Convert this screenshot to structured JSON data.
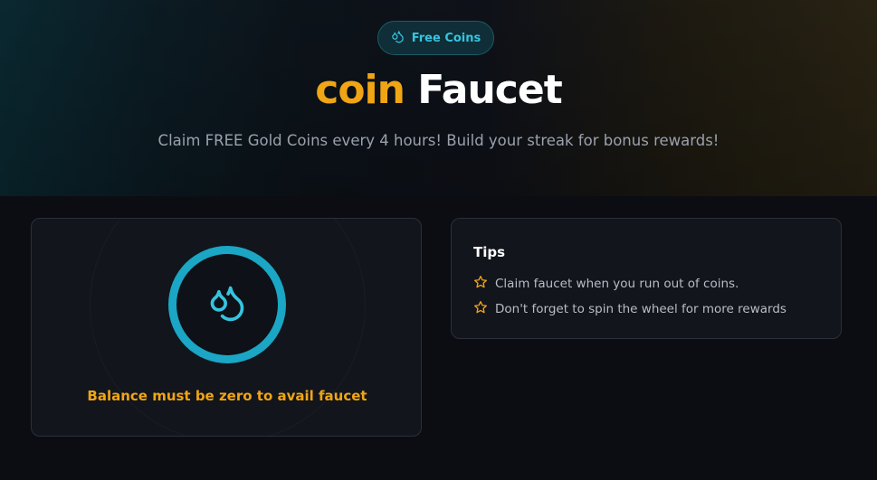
{
  "hero": {
    "badge_label": "Free Coins",
    "badge_icon": "droplets-icon",
    "title_accent": "coin",
    "title_main": "Faucet",
    "subtitle": "Claim FREE Gold Coins every 4 hours! Build your streak for bonus rewards!"
  },
  "faucet": {
    "icon": "droplets-icon",
    "message": "Balance must be zero to avail faucet"
  },
  "tips": {
    "title": "Tips",
    "items": [
      {
        "icon": "star-icon",
        "text": "Claim faucet when you run out of coins."
      },
      {
        "icon": "star-icon",
        "text": "Don't forget to spin the wheel for more rewards"
      }
    ]
  },
  "colors": {
    "accent_gold": "#f0a515",
    "accent_cyan": "#1aa6c4",
    "background": "#0b0d12",
    "card": "#12151c"
  }
}
